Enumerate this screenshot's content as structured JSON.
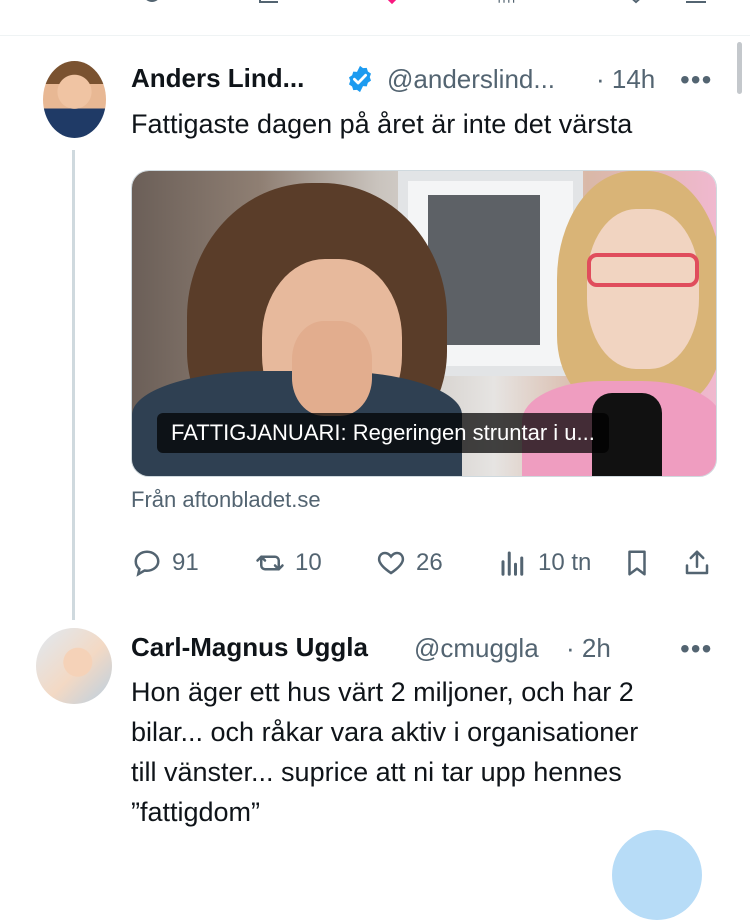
{
  "tweet1": {
    "display_name": "Anders Lind...",
    "handle": "@anderslind...",
    "time": "· 14h",
    "more": "•••",
    "text": "Fattigaste dagen på året är inte det värsta",
    "card": {
      "caption": "FATTIGJANUARI: Regeringen struntar i u...",
      "source": "Från aftonbladet.se"
    },
    "actions": {
      "replies": "91",
      "retweets": "10",
      "likes": "26",
      "views": "10 tn"
    }
  },
  "tweet2": {
    "display_name": "Carl-Magnus Uggla",
    "handle": "@cmuggla",
    "time": "· 2h",
    "more": "•••",
    "text_lines": [
      "Hon äger ett hus värt 2 miljoner, och har 2",
      "bilar... och råkar vara aktiv i organisationer",
      "till vänster... suprice att ni tar upp hennes",
      "”fattigdom”"
    ]
  },
  "colors": {
    "text_primary": "#0f1419",
    "text_secondary": "#536471",
    "verified_blue": "#1d9bf0",
    "divider": "#eff3f4"
  }
}
